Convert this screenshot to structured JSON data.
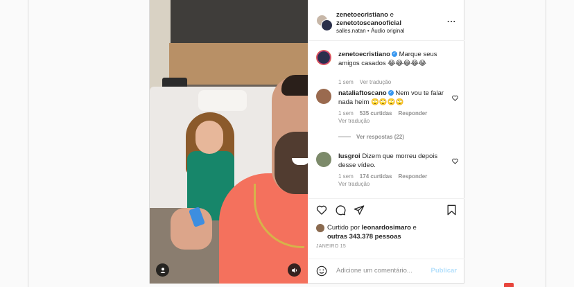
{
  "post": {
    "header": {
      "author1": "zenetoecristiano",
      "connector": " e ",
      "author2": "zenetotoscanooficial",
      "audio_user": "salles.natan",
      "audio_sep": " • ",
      "audio_label": "Áudio original",
      "more": "..."
    },
    "caption": {
      "username": "zenetoecristiano",
      "text": "Marque seus amigos casados 😂😂😂😂😂",
      "time": "1 sem",
      "translate": "Ver tradução"
    },
    "comments": [
      {
        "username": "nataliaftoscano",
        "text": "Nem vou te falar nada heim 🙄🙄🙄🙄",
        "time": "1 sem",
        "likes": "535 curtidas",
        "reply": "Responder",
        "translate": "Ver tradução",
        "replies": "Ver respostas (22)"
      },
      {
        "username": "lusgroi",
        "text": "Dizem que morreu depois desse vídeo.",
        "time": "1 sem",
        "likes": "174 curtidas",
        "reply": "Responder",
        "translate": "Ver tradução"
      }
    ],
    "likes": {
      "prefix": "Curtido por ",
      "user": "leonardosimaro",
      "middle": " e ",
      "others": "outras 343.378 pessoas"
    },
    "date": "JANEIRO 15",
    "add_comment": {
      "placeholder": "Adicione um comentário...",
      "publish": "Publicar"
    }
  },
  "colors": {
    "link": "#3897f0",
    "muted": "#8e8e8e",
    "publish_disabled": "#b2dffc",
    "border": "#dbdbdb"
  },
  "icons": [
    "user-tag-icon",
    "sound-icon",
    "heart-icon",
    "comment-icon",
    "share-icon",
    "bookmark-icon",
    "emoji-icon",
    "more-icon",
    "verified-icon"
  ]
}
